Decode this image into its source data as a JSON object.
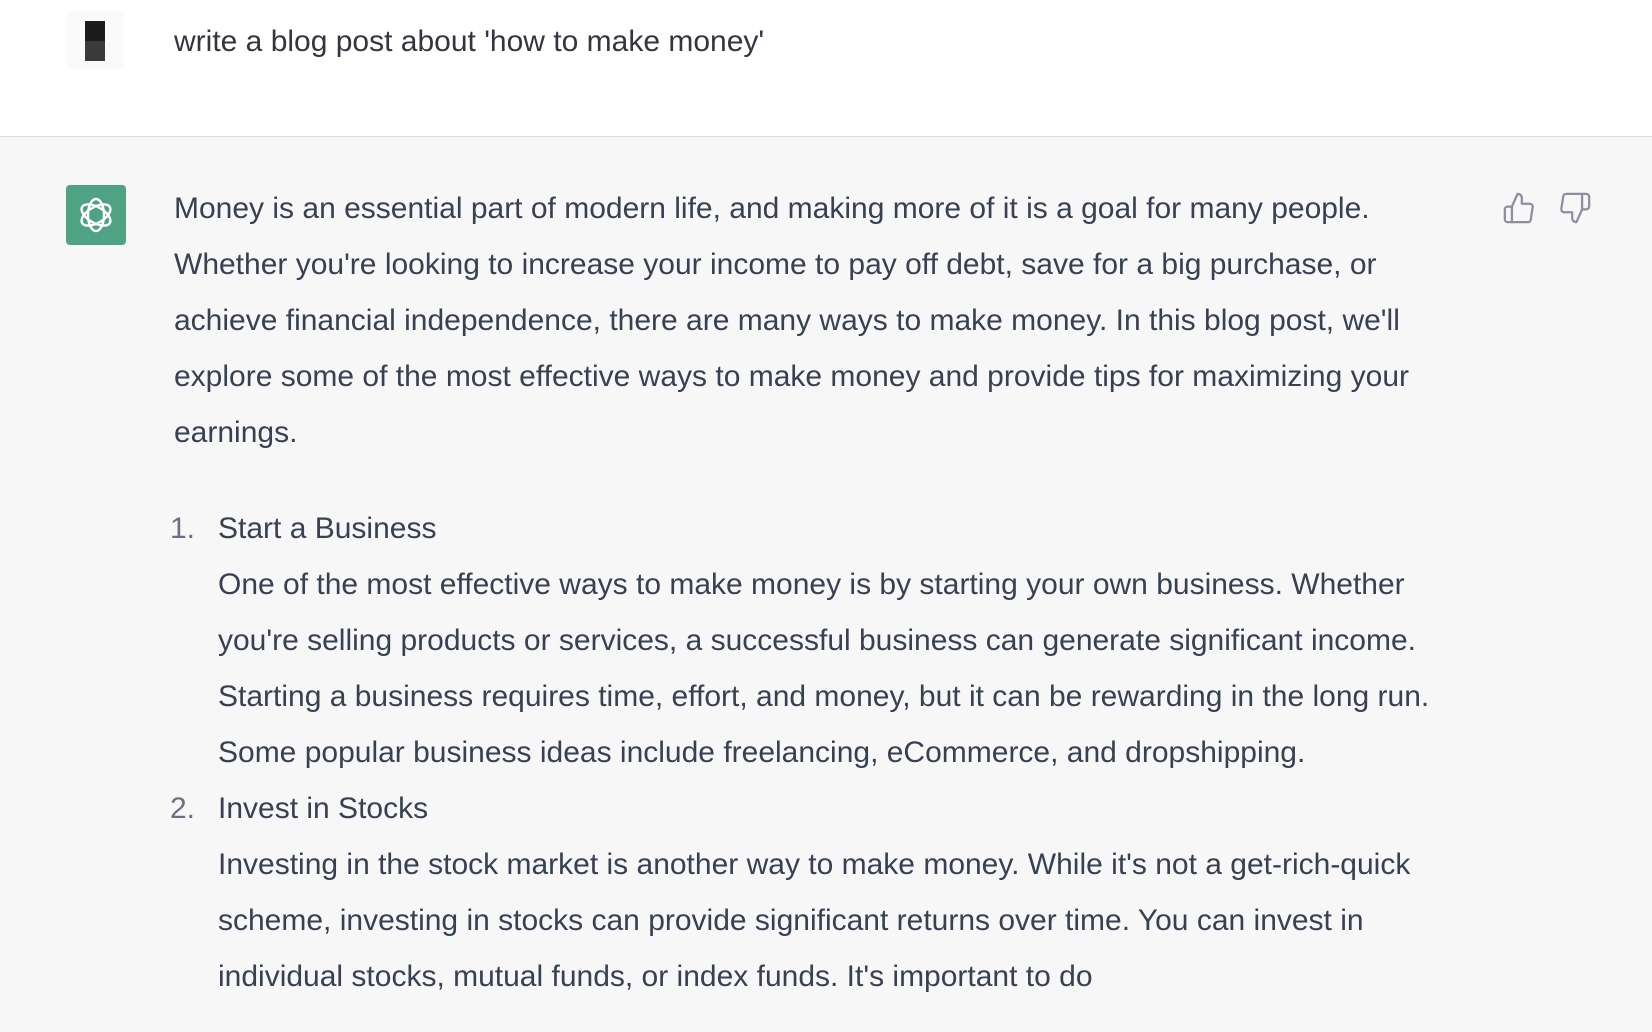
{
  "user_message": {
    "text": "write a blog post about 'how to make money'"
  },
  "assistant_message": {
    "intro": "Money is an essential part of modern life, and making more of it is a goal for many people. Whether you're looking to increase your income to pay off debt, save for a big purchase, or achieve financial independence, there are many ways to make money. In this blog post, we'll explore some of the most effective ways to make money and provide tips for maximizing your earnings.",
    "items": [
      {
        "number": "1.",
        "title": "Start a Business",
        "body": "One of the most effective ways to make money is by starting your own business. Whether you're selling products or services, a successful business can generate significant income. Starting a business requires time, effort, and money, but it can be rewarding in the long run. Some popular business ideas include freelancing, eCommerce, and dropshipping."
      },
      {
        "number": "2.",
        "title": "Invest in Stocks",
        "body": "Investing in the stock market is another way to make money. While it's not a get-rich-quick scheme, investing in stocks can provide significant returns over time. You can invest in individual stocks, mutual funds, or index funds. It's important to do"
      }
    ]
  },
  "icons": {
    "user_avatar": "pixel-avatar",
    "assistant_avatar": "openai-logo-icon",
    "feedback_up": "thumbs-up-icon",
    "feedback_down": "thumbs-down-icon"
  },
  "colors": {
    "assistant_avatar_bg": "#4fa384",
    "assistant_row_bg": "#f7f7f8",
    "text": "#374151"
  }
}
